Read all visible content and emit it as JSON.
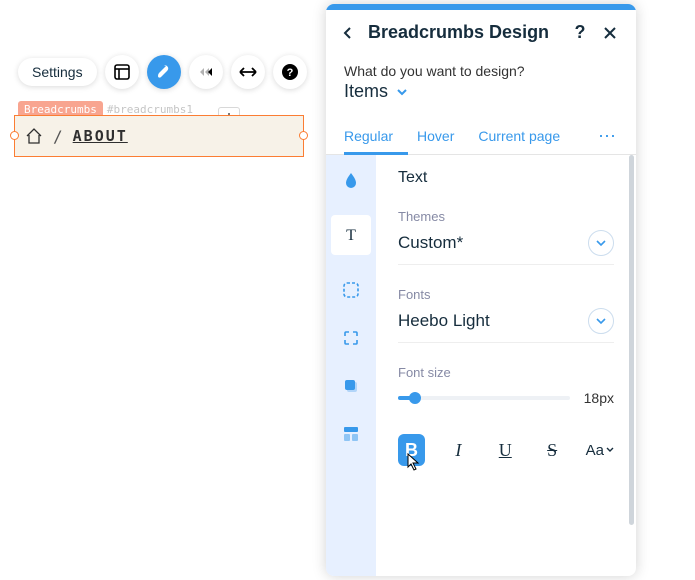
{
  "toolbar": {
    "settings_label": "Settings"
  },
  "tags": {
    "label": "Breadcrumbs",
    "id": "#breadcrumbs1"
  },
  "breadcrumb": {
    "separator": "/",
    "page": "ABOUT"
  },
  "panel": {
    "title": "Breadcrumbs Design",
    "design_prompt": "What do you want to design?",
    "design_value": "Items",
    "tabs": {
      "regular": "Regular",
      "hover": "Hover",
      "current": "Current page"
    },
    "section_title": "Text",
    "themes_label": "Themes",
    "themes_value": "Custom*",
    "fonts_label": "Fonts",
    "fonts_value": "Heebo Light",
    "fontsize_label": "Font size",
    "fontsize_value": "18px",
    "format": {
      "bold": "B",
      "italic": "I",
      "underline": "U",
      "strike": "S",
      "case": "Aa"
    }
  }
}
